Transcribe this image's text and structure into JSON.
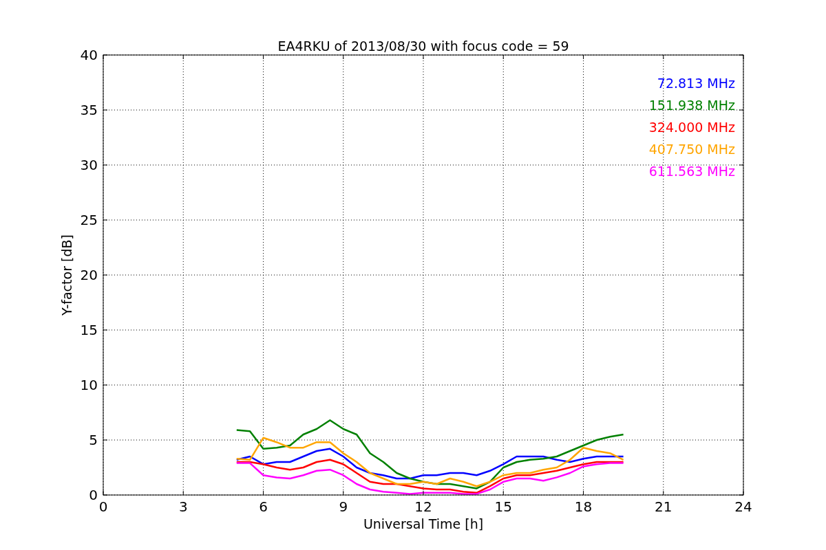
{
  "chart_data": {
    "type": "line",
    "title": "EA4RKU of 2013/08/30 with focus code = 59",
    "xlabel": "Universal Time [h]",
    "ylabel": "Y-factor [dB]",
    "x": [
      5,
      5.5,
      6,
      6.5,
      7,
      7.5,
      8,
      8.5,
      9,
      9.5,
      10,
      10.5,
      11,
      11.5,
      12,
      12.5,
      13,
      13.5,
      14,
      14.5,
      15,
      15.5,
      16,
      16.5,
      17,
      17.5,
      18,
      18.5,
      19,
      19.5
    ],
    "series": [
      {
        "name": "72.813 MHz",
        "color": "#0000ff",
        "values": [
          3.2,
          3.5,
          2.8,
          3.0,
          3.0,
          3.5,
          4.0,
          4.2,
          3.5,
          2.5,
          2.0,
          1.8,
          1.5,
          1.5,
          1.8,
          1.8,
          2.0,
          2.0,
          1.8,
          2.2,
          2.8,
          3.5,
          3.5,
          3.5,
          3.2,
          3.0,
          3.3,
          3.5,
          3.5,
          3.5
        ]
      },
      {
        "name": "151.938 MHz",
        "color": "#008000",
        "values": [
          5.9,
          5.8,
          4.2,
          4.3,
          4.5,
          5.5,
          6.0,
          6.8,
          6.0,
          5.5,
          3.8,
          3.0,
          2.0,
          1.5,
          1.2,
          1.0,
          1.0,
          0.8,
          0.6,
          1.2,
          2.5,
          3.0,
          3.2,
          3.3,
          3.5,
          4.0,
          4.5,
          5.0,
          5.3,
          5.5
        ]
      },
      {
        "name": "324.000 MHz",
        "color": "#ff0000",
        "values": [
          3.0,
          3.0,
          2.8,
          2.5,
          2.3,
          2.5,
          3.0,
          3.2,
          2.8,
          2.0,
          1.2,
          1.0,
          1.0,
          0.8,
          0.6,
          0.5,
          0.5,
          0.3,
          0.2,
          0.8,
          1.5,
          1.8,
          1.8,
          2.0,
          2.2,
          2.5,
          2.8,
          3.0,
          3.0,
          3.0
        ]
      },
      {
        "name": "407.750 MHz",
        "color": "#ffa500",
        "values": [
          3.3,
          3.2,
          5.2,
          4.8,
          4.3,
          4.3,
          4.8,
          4.8,
          3.8,
          3.0,
          2.0,
          1.5,
          1.0,
          1.0,
          1.2,
          1.0,
          1.5,
          1.2,
          0.8,
          1.2,
          1.8,
          2.0,
          2.0,
          2.3,
          2.5,
          3.2,
          4.3,
          4.0,
          3.8,
          3.2
        ]
      },
      {
        "name": "611.563 MHz",
        "color": "#ff00ff",
        "values": [
          2.9,
          2.9,
          1.8,
          1.6,
          1.5,
          1.8,
          2.2,
          2.3,
          1.8,
          1.0,
          0.5,
          0.3,
          0.2,
          0.1,
          0.2,
          0.2,
          0.2,
          0.1,
          0.1,
          0.5,
          1.2,
          1.5,
          1.5,
          1.3,
          1.6,
          2.0,
          2.6,
          2.8,
          2.9,
          2.9
        ]
      }
    ],
    "xlim": [
      0,
      24
    ],
    "ylim": [
      0,
      40
    ],
    "xticks": [
      0,
      3,
      6,
      9,
      12,
      15,
      18,
      21,
      24
    ],
    "yticks": [
      0,
      5,
      10,
      15,
      20,
      25,
      30,
      35,
      40
    ],
    "grid": true
  }
}
